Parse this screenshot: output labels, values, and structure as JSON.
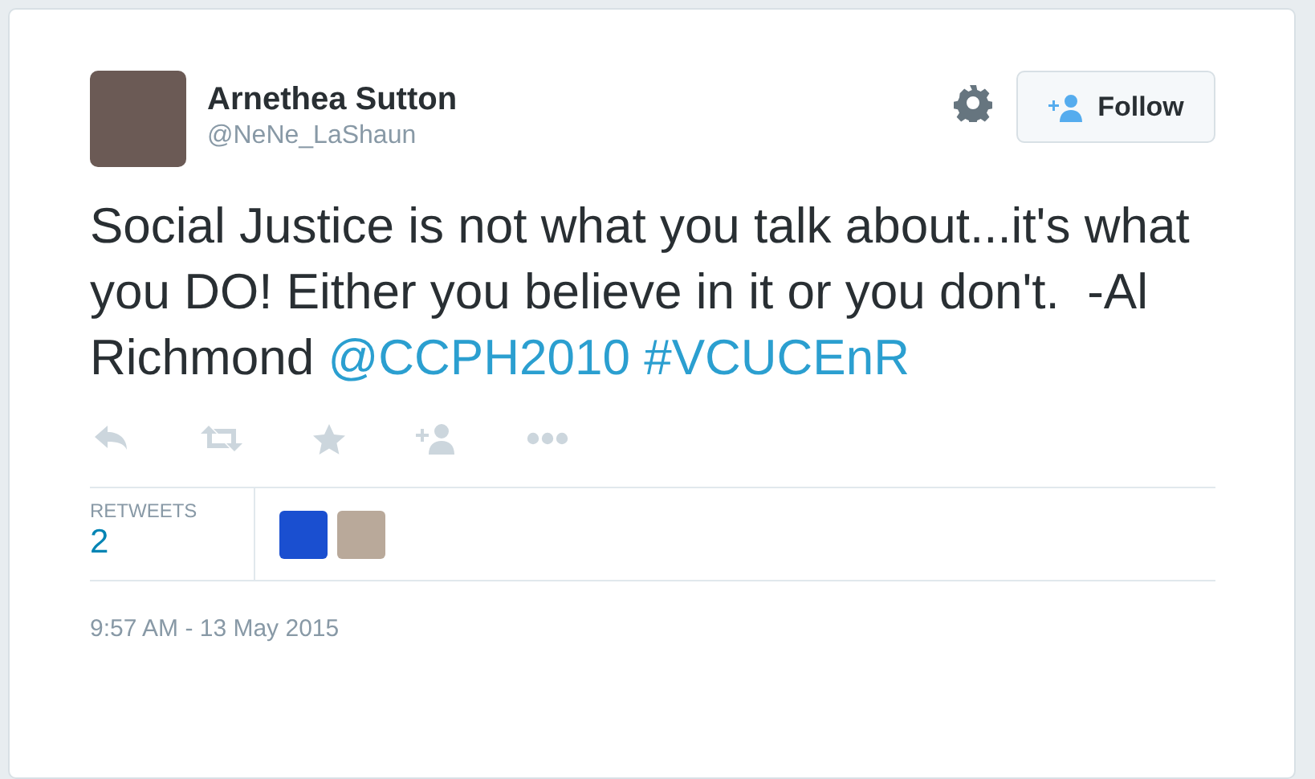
{
  "user": {
    "name": "Arnethea Sutton",
    "handle": "@NeNe_LaShaun"
  },
  "follow_button": {
    "label": "Follow"
  },
  "tweet": {
    "segments": [
      {
        "kind": "text",
        "text": "Social Justice is not what you talk about...it's what you DO! Either you believe in it or you don't.  -Al Richmond"
      },
      {
        "kind": "mention",
        "text": "@CCPH2010"
      },
      {
        "kind": "hashtag",
        "text": "#VCUCEnR"
      }
    ]
  },
  "stats": {
    "label": "RETWEETS",
    "count": "2",
    "retweeters": [
      {
        "kind": "logo"
      },
      {
        "kind": "photo"
      }
    ]
  },
  "timestamp": "9:57 AM - 13 May 2015"
}
